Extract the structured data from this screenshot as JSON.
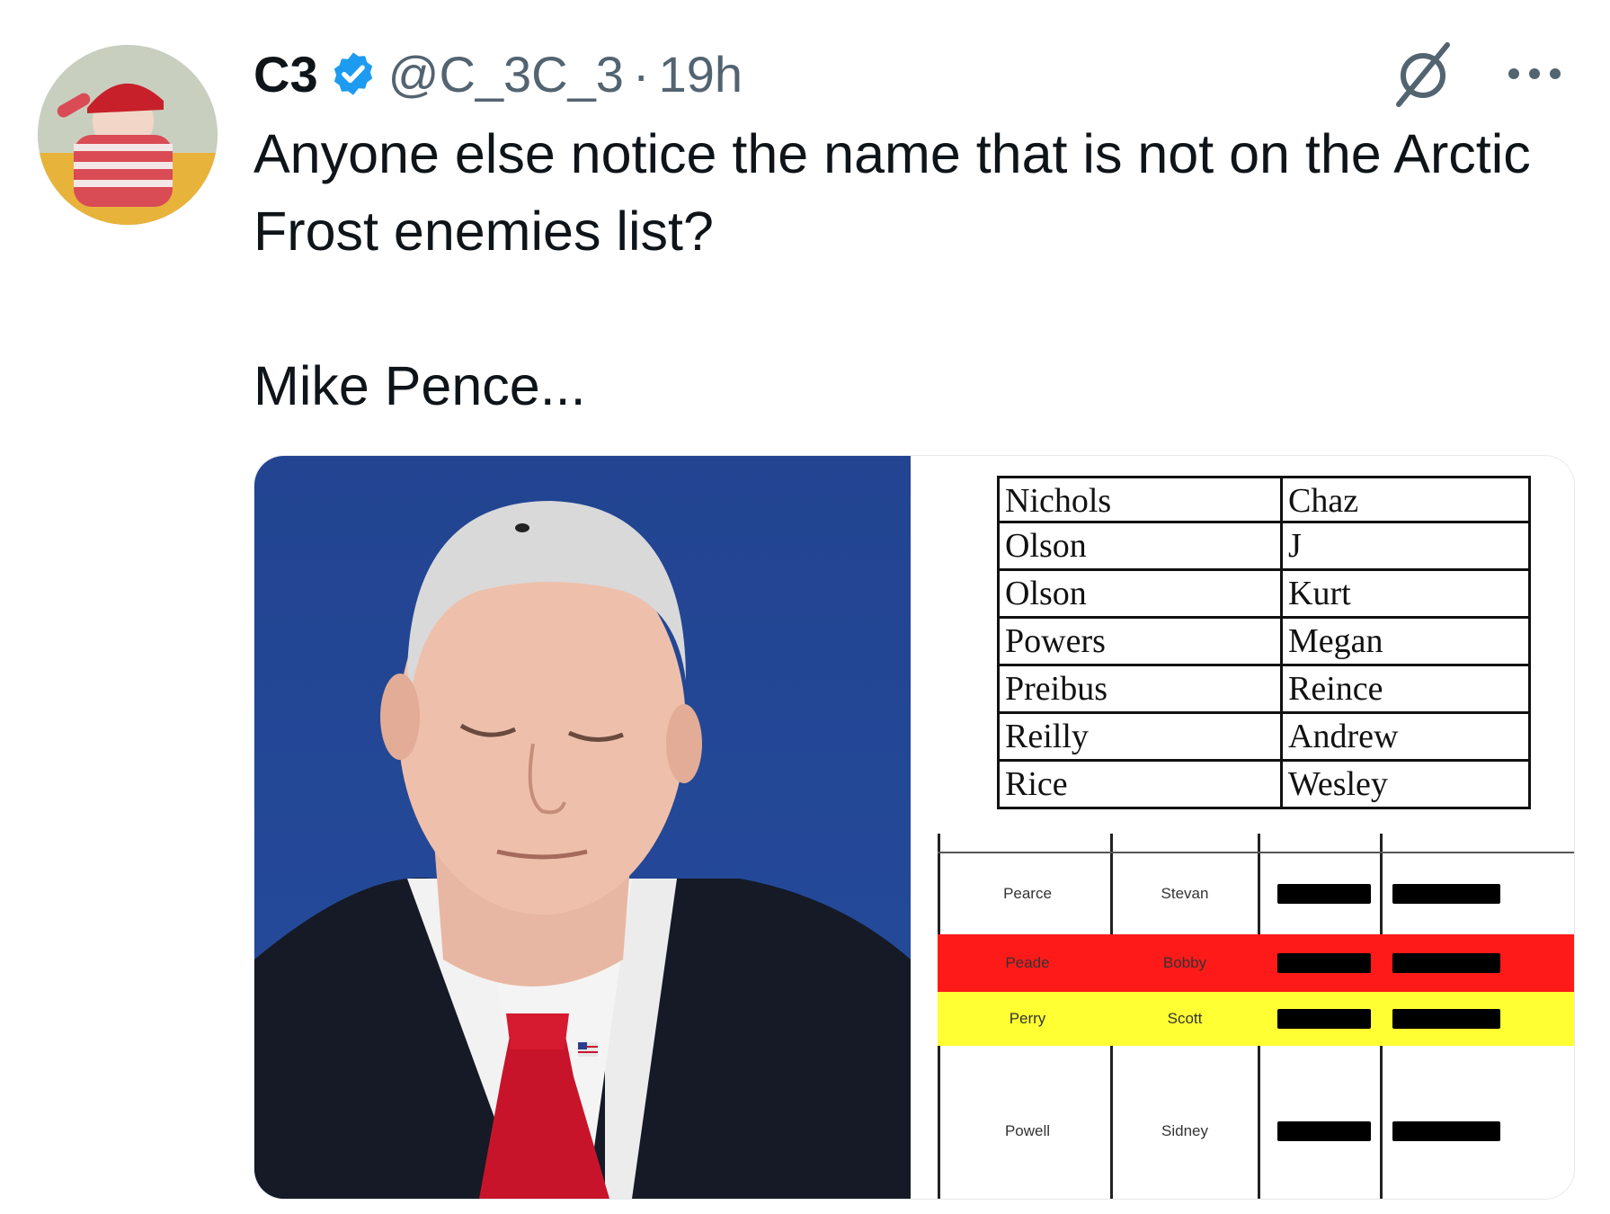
{
  "tweet": {
    "author_name": "C3",
    "handle": "@C_3C_3",
    "separator": "·",
    "time": "19h",
    "text": "Anyone else notice the name that is not on the Arctic Frost enemies list?\n\nMike Pence..."
  },
  "icons": {
    "verified": "verified-badge-icon",
    "grok": "grok-icon",
    "more": "more-options-icon"
  },
  "colors": {
    "verified_blue": "#1d9bf0",
    "secondary_text": "#536471",
    "highlight_red": "#ff1a1a",
    "highlight_yellow": "#ffff33"
  },
  "document": {
    "upper_rows": [
      {
        "last": "Nichols",
        "first": "Chaz"
      },
      {
        "last": "Olson",
        "first": "J"
      },
      {
        "last": "Olson",
        "first": "Kurt"
      },
      {
        "last": "Powers",
        "first": "Megan"
      },
      {
        "last": "Preibus",
        "first": "Reince"
      },
      {
        "last": "Reilly",
        "first": "Andrew"
      },
      {
        "last": "Rice",
        "first": "Wesley"
      }
    ],
    "lower_rows": [
      {
        "last": "Pearce",
        "first": "Stevan",
        "highlight": "none"
      },
      {
        "last": "Peade",
        "first": "Bobby",
        "highlight": "red"
      },
      {
        "last": "Perry",
        "first": "Scott",
        "highlight": "yellow"
      },
      {
        "last": "Powell",
        "first": "Sidney",
        "highlight": "none"
      }
    ]
  }
}
